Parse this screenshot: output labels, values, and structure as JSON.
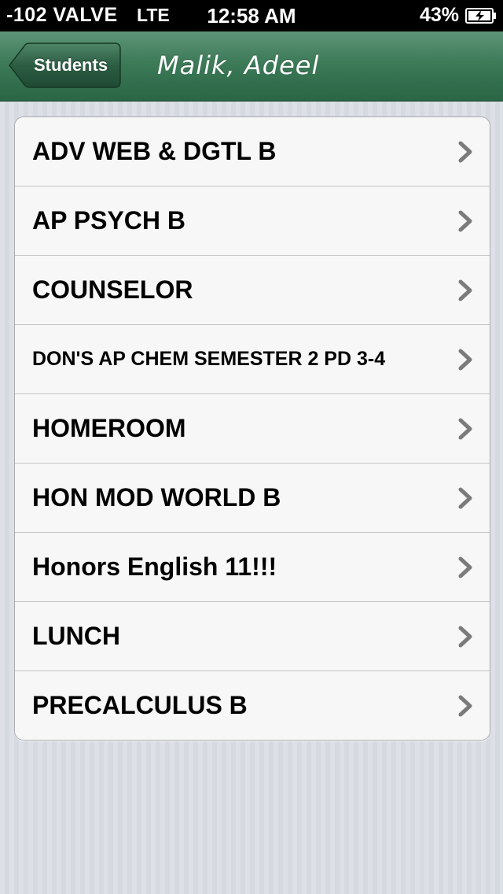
{
  "status_bar": {
    "carrier": "-102 VALVE",
    "network": "LTE",
    "time": "12:58 AM",
    "battery_percent": "43%",
    "battery_icon": "battery-charging-icon"
  },
  "nav": {
    "back_label": "Students",
    "title": "Malik, Adeel",
    "bar_color": "#3c7a58"
  },
  "courses": [
    {
      "label": "ADV WEB & DGTL B"
    },
    {
      "label": "AP PSYCH B"
    },
    {
      "label": "COUNSELOR"
    },
    {
      "label": "DON'S AP CHEM SEMESTER 2 PD 3-4"
    },
    {
      "label": "HOMEROOM"
    },
    {
      "label": "HON MOD WORLD B"
    },
    {
      "label": "Honors English 11!!!"
    },
    {
      "label": "LUNCH"
    },
    {
      "label": "PRECALCULUS B"
    }
  ],
  "row_icon": "chevron-right-icon"
}
